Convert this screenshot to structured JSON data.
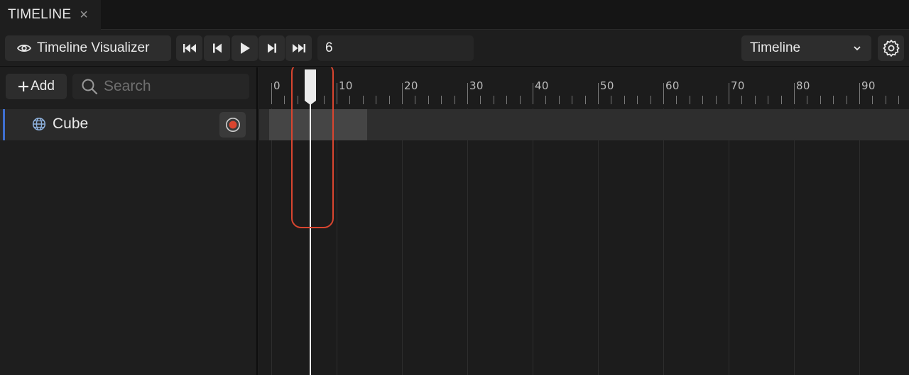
{
  "tab": {
    "label": "TIMELINE",
    "close": "×"
  },
  "toolbar": {
    "visualizer_label": "Timeline Visualizer",
    "transport": [
      "go-to-start-icon",
      "step-back-icon",
      "play-icon",
      "step-forward-icon",
      "go-to-end-icon"
    ],
    "frame_value": "6",
    "mode_selected": "Timeline"
  },
  "left_panel": {
    "add_label": "Add",
    "search_placeholder": "Search",
    "tracks": [
      {
        "label": "Cube",
        "icon": "globe-icon"
      }
    ]
  },
  "timeline": {
    "ruler_labels": [
      "0",
      "10",
      "20",
      "30",
      "40",
      "50",
      "60",
      "70",
      "80",
      "90"
    ],
    "current_frame": 6,
    "clip": {
      "start": 0,
      "end": 15
    }
  },
  "colors": {
    "accent": "#3f6fd0",
    "record": "#d9452f",
    "highlight": "#d9452f"
  }
}
